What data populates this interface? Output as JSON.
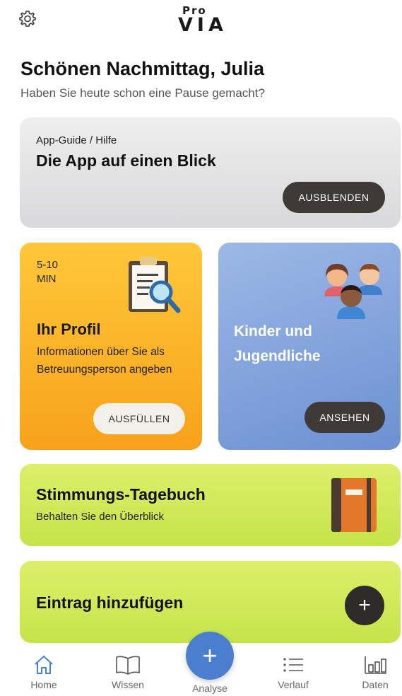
{
  "header": {
    "logo_top": "Pro",
    "logo_bottom": "VIA",
    "settings_icon": "gear-icon"
  },
  "greeting": {
    "title": "Schönen Nachmittag, Julia",
    "subtitle": "Haben Sie heute schon eine Pause gemacht?"
  },
  "guide_card": {
    "small": "App-Guide / Hilfe",
    "title": "Die App auf einen Blick",
    "button": "AUSBLENDEN"
  },
  "profile_card": {
    "time_line1": "5-10",
    "time_line2": "MIN",
    "title": "Ihr Profil",
    "description": "Informationen über Sie als Betreuungsperson angeben",
    "button": "AUSFÜLLEN",
    "color": "#f9b12b"
  },
  "kids_card": {
    "title": "Kinder und Jugendliche",
    "button": "ANSEHEN",
    "color": "#7d9fdc"
  },
  "diary_card": {
    "title": "Stimmungs-Tagebuch",
    "subtitle": "Behalten Sie den Überblick",
    "color": "#cfe757"
  },
  "add_card": {
    "title": "Eintrag hinzufügen",
    "button_symbol": "+"
  },
  "tabbar": {
    "items": [
      {
        "label": "Home",
        "icon": "home-icon"
      },
      {
        "label": "Wissen",
        "icon": "book-icon"
      },
      {
        "label": "Analyse",
        "icon": "plus-icon"
      },
      {
        "label": "Verlauf",
        "icon": "list-icon"
      },
      {
        "label": "Daten",
        "icon": "bar-chart-icon"
      }
    ],
    "fab_symbol": "+",
    "accent": "#4a7fd0"
  }
}
